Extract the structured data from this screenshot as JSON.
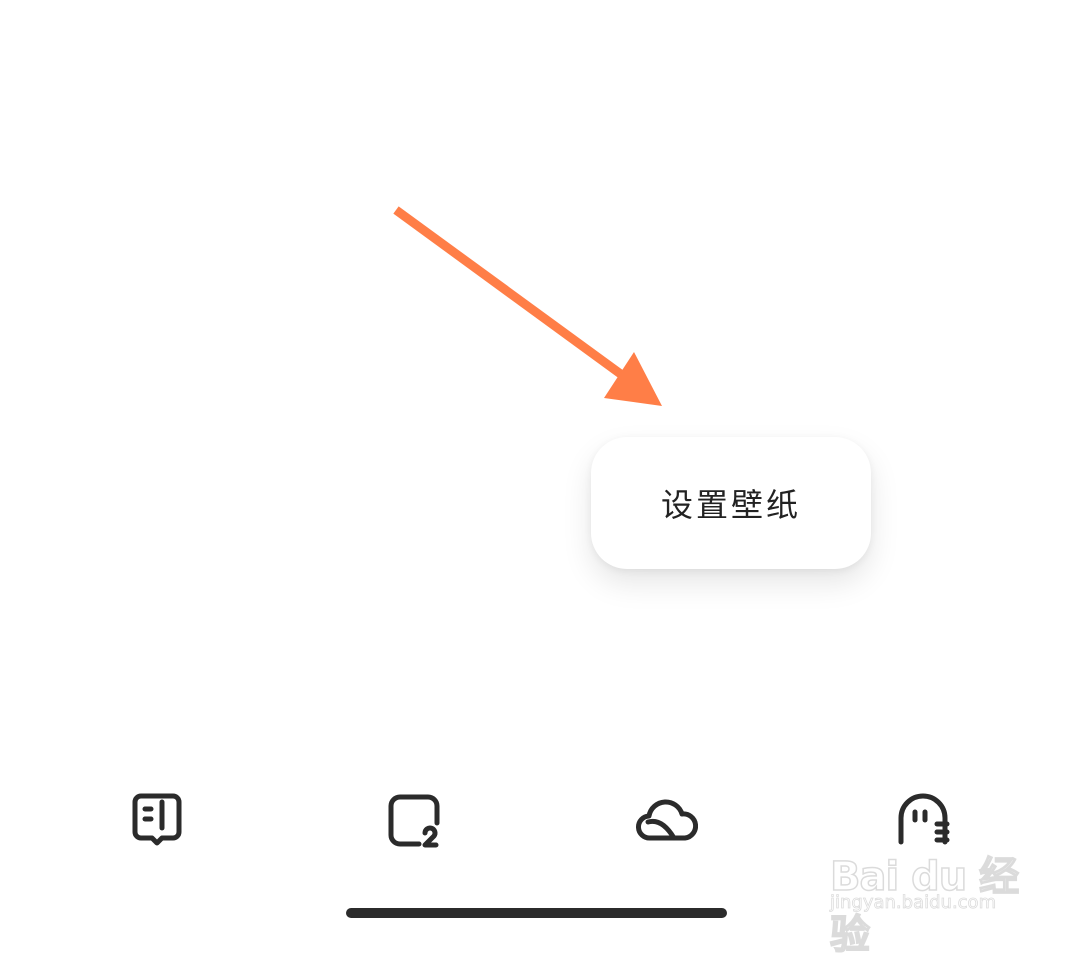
{
  "popup": {
    "label": "设置壁纸"
  },
  "annotation": {
    "arrow_color": "#FF7E47"
  },
  "tab_bar": {
    "items": [
      {
        "icon": "book-icon"
      },
      {
        "icon": "square-2-icon"
      },
      {
        "icon": "cloud-icon"
      },
      {
        "icon": "ghost-icon"
      }
    ],
    "icon_color": "#2b2b2b"
  },
  "watermark": {
    "logo": "Bai du 经验",
    "url": "jingyan.baidu.com"
  }
}
